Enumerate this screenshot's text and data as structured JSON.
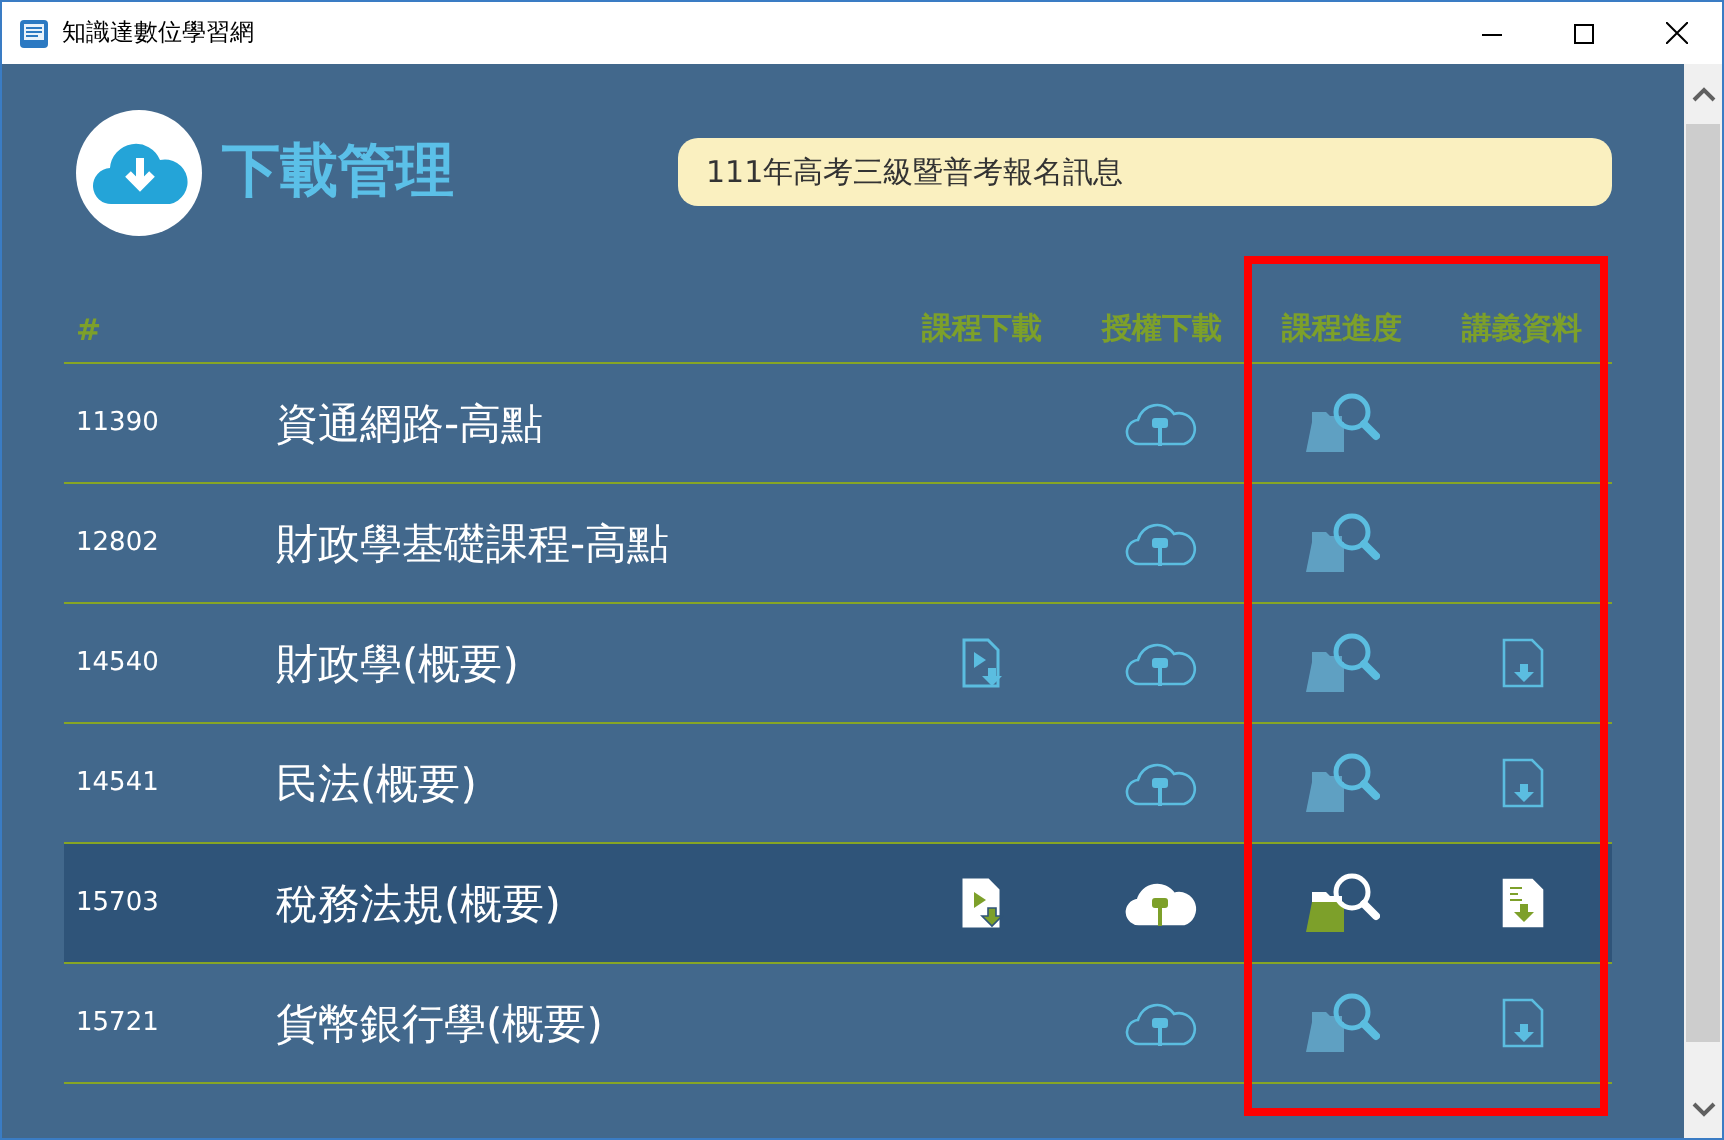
{
  "window": {
    "title": "知識達數位學習網"
  },
  "header": {
    "title": "下載管理",
    "notice": "111年高考三級暨普考報名訊息"
  },
  "table": {
    "columns": [
      "#",
      "課程下載",
      "授權下載",
      "課程進度",
      "講義資料"
    ],
    "rows": [
      {
        "id": "11390",
        "name": "資通網路-高點",
        "course_download": false,
        "license_download": true,
        "progress": true,
        "handout": false,
        "selected": false
      },
      {
        "id": "12802",
        "name": "財政學基礎課程-高點",
        "course_download": false,
        "license_download": true,
        "progress": true,
        "handout": false,
        "selected": false
      },
      {
        "id": "14540",
        "name": "財政學(概要)",
        "course_download": true,
        "license_download": true,
        "progress": true,
        "handout": true,
        "selected": false
      },
      {
        "id": "14541",
        "name": "民法(概要)",
        "course_download": false,
        "license_download": true,
        "progress": true,
        "handout": true,
        "selected": false
      },
      {
        "id": "15703",
        "name": "稅務法規(概要)",
        "course_download": true,
        "license_download": true,
        "progress": true,
        "handout": true,
        "selected": true
      },
      {
        "id": "15721",
        "name": "貨幣銀行學(概要)",
        "course_download": false,
        "license_download": true,
        "progress": true,
        "handout": true,
        "selected": false
      }
    ]
  },
  "annotation": {
    "kind": "frame"
  }
}
